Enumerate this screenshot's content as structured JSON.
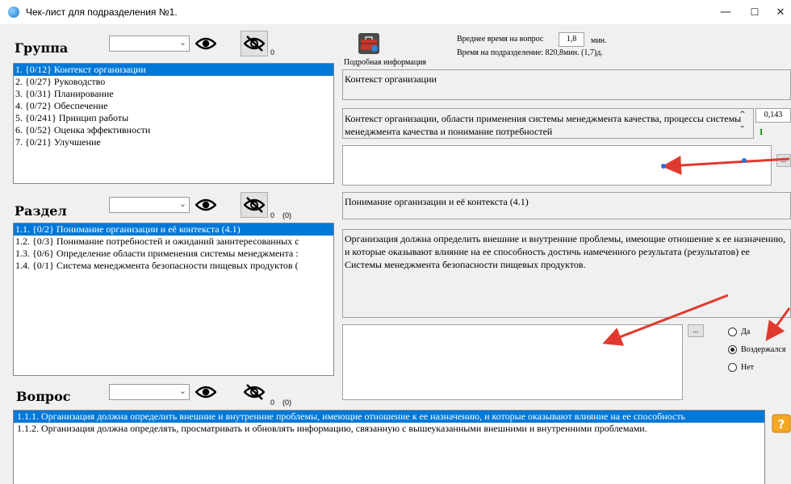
{
  "window": {
    "title": "Чек-лист для подразделения №1.",
    "controls": {
      "minimize": "—",
      "maximize": "☐",
      "close": "✕"
    }
  },
  "group": {
    "heading": "Группа",
    "combo_value": "",
    "hidden_count": "0",
    "items": [
      {
        "label": "1. {0/12} Контекст организации",
        "selected": true
      },
      {
        "label": "2. {0/27} Руководство",
        "selected": false
      },
      {
        "label": "3. {0/31} Планирование",
        "selected": false
      },
      {
        "label": "4. {0/72} Обеспечение",
        "selected": false
      },
      {
        "label": "5. {0/241} Принцип работы",
        "selected": false
      },
      {
        "label": "6. {0/52} Оценка эффективности",
        "selected": false
      },
      {
        "label": "7. {0/21} Улучшение",
        "selected": false
      }
    ]
  },
  "section": {
    "heading": "Раздел",
    "combo_value": "",
    "hidden_count": "0",
    "hidden_extra": "(0)",
    "items": [
      {
        "label": "1.1. {0/2} Понимание организации и её контекста (4.1)",
        "selected": true
      },
      {
        "label": "1.2. {0/3} Понимание потребностей и ожиданий заинтересованных с",
        "selected": false
      },
      {
        "label": "1.3. {0/6} Определение области применения системы менеджмента :",
        "selected": false
      },
      {
        "label": "1.4. {0/1} Система менеджмента безопасности пищевых продуктов (",
        "selected": false
      }
    ]
  },
  "question": {
    "heading": "Вопрос",
    "combo_value": "",
    "hidden_count": "0",
    "hidden_extra": "(0)",
    "items": [
      {
        "label": "1.1.1. Организация должна определить внешние и внутренние проблемы, имеющие отношение к ее назначению, и которые оказывают влияние на ее способность",
        "selected": true
      },
      {
        "label": "1.1.2. Организация должна определять, просматривать и обновлять информацию, связанную с вышеуказанными внешними и внутренними проблемами.",
        "selected": false
      }
    ]
  },
  "timing": {
    "avg_label": "Вреднее время на вопрос",
    "avg_value": "1,8",
    "avg_unit": "мин.",
    "dept_time": "Время на подразделение: 820,8мин. (1,7)д."
  },
  "details": {
    "caption": "Подробная информация",
    "group_name": "Контекст организации",
    "group_description": "Контекст организации, области применения системы менеджмента качества, процессы системы менеджмента качества и понимание потребностей",
    "weight_value": "0,143",
    "counter_value": "1",
    "browse_label": "...",
    "section_name": "Понимание организации и её контекста (4.1)",
    "question_text": "Организация должна определить внешние и внутренние проблемы, имеющие отношение к ее назначению, и которые оказывают влияние на ее способность достичь намеченного результата (результатов) ее Системы менеджмента безопасности пищевых продуктов.",
    "comment_browse_label": "...",
    "comment_text": ""
  },
  "answers": [
    {
      "label": "Да",
      "checked": false
    },
    {
      "label": "Воздержался",
      "checked": true
    },
    {
      "label": "Нет",
      "checked": false
    }
  ],
  "colors": {
    "selection": "#0078d7",
    "arrow": "#e03a2f",
    "counter_green": "#1a8f1a"
  }
}
